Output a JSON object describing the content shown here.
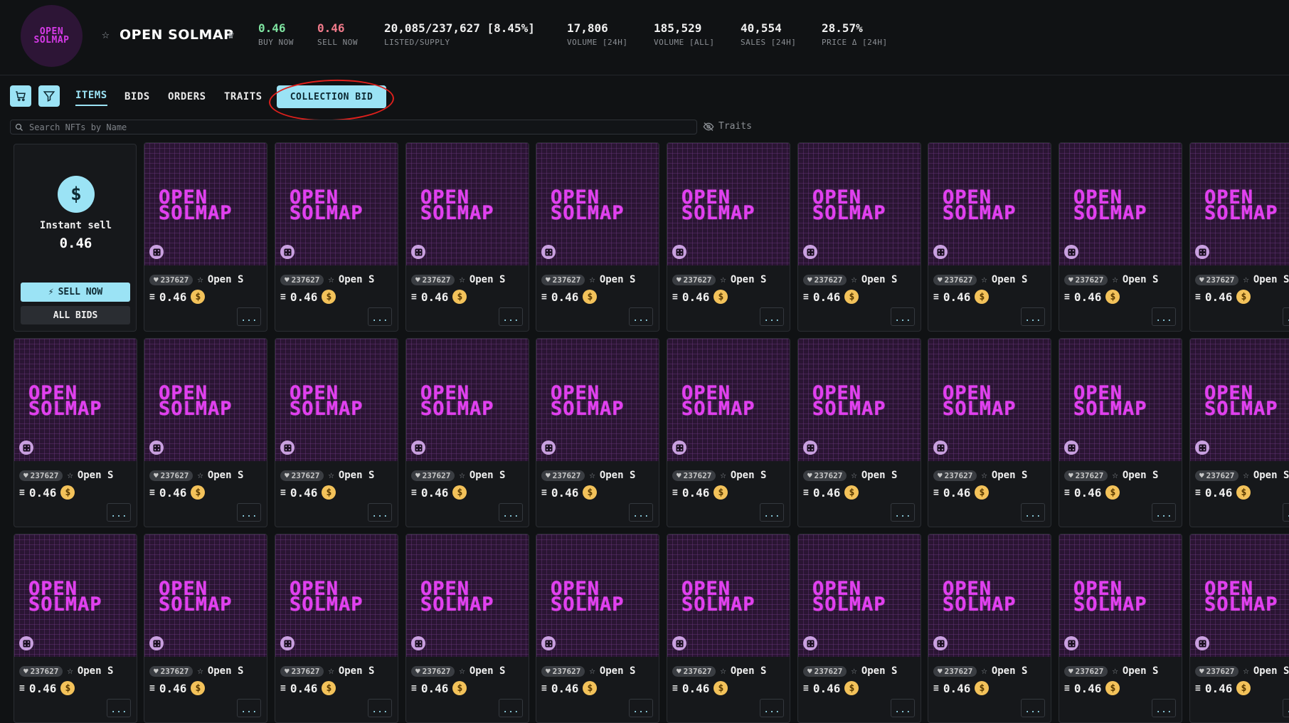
{
  "collection": {
    "logo_line1": "OPEN",
    "logo_line2": "SOLMAP",
    "title": "OPEN SOLMAP"
  },
  "stats": [
    {
      "value": "0.46",
      "label": "BUY NOW",
      "color": "#7ee3a0"
    },
    {
      "value": "0.46",
      "label": "SELL NOW",
      "color": "#f07a8a"
    },
    {
      "value": "20,085/237,627 [8.45%]",
      "label": "LISTED/SUPPLY",
      "color": "#f0f0f0"
    },
    {
      "value": "17,806",
      "label": "VOLUME [24H]",
      "color": "#f0f0f0"
    },
    {
      "value": "185,529",
      "label": "VOLUME [ALL]",
      "color": "#f0f0f0"
    },
    {
      "value": "40,554",
      "label": "SALES [24H]",
      "color": "#f0f0f0"
    },
    {
      "value": "28.57%",
      "label": "PRICE Δ [24H]",
      "color": "#f0f0f0"
    }
  ],
  "toolbar": {
    "tabs": [
      "ITEMS",
      "BIDS",
      "ORDERS",
      "TRAITS"
    ],
    "active_tab": "ITEMS",
    "collection_bid_label": "COLLECTION BID"
  },
  "search": {
    "placeholder": "Search NFTs by Name",
    "value": "",
    "traits_label": "Traits"
  },
  "instant_sell": {
    "label": "Instant sell",
    "value": "0.46",
    "sell_now_label": "SELL NOW",
    "all_bids_label": "ALL BIDS"
  },
  "nft_item": {
    "image_line1": "OPEN",
    "image_line2": "SOLMAP",
    "badge": "237627",
    "name": "Open S",
    "price": "0.46",
    "more_label": "..."
  },
  "colors": {
    "accent": "#9be3f5",
    "nft_pink": "#e13ff0",
    "coin": "#f3c25a",
    "annotation_ring": "#e0201c"
  }
}
